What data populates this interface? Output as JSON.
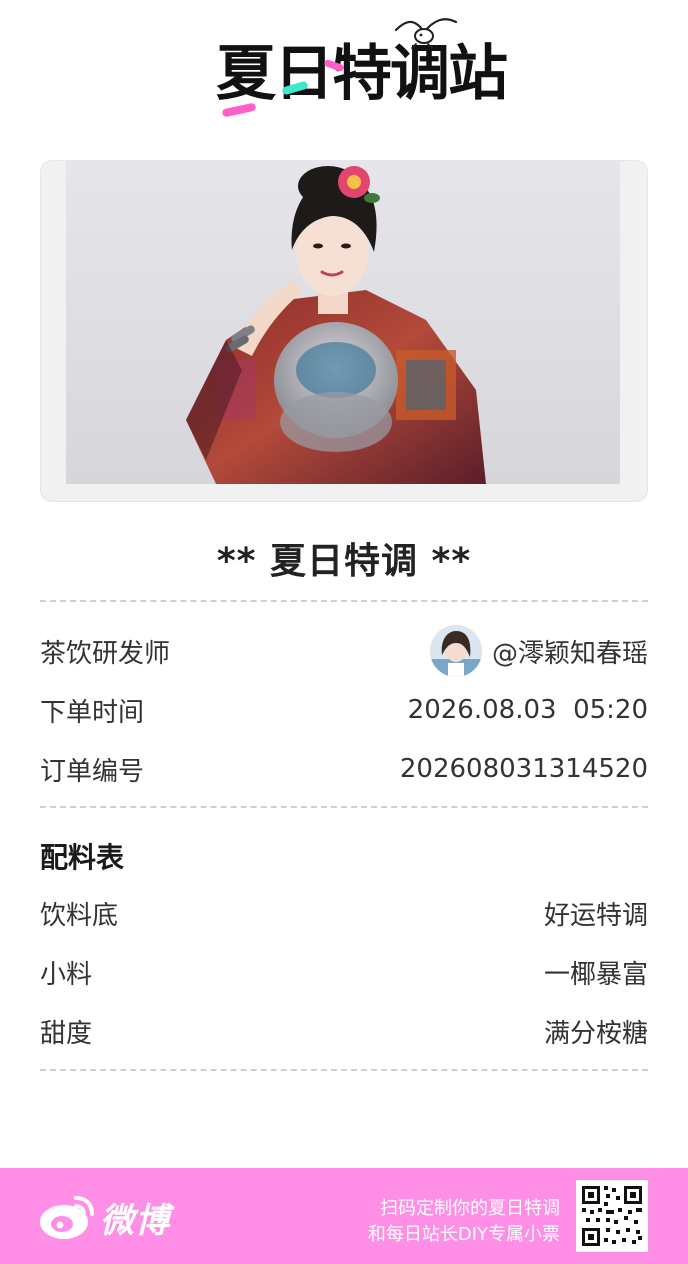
{
  "header": {
    "logo_text": "夏日特调站"
  },
  "ticket": {
    "title": "** 夏日特调 **",
    "info_rows": [
      {
        "label": "茶饮研发师",
        "value": "@澪颖知春瑶"
      },
      {
        "label": "下单时间",
        "value": "2026.08.03  05:20"
      },
      {
        "label": "订单编号",
        "value": "202608031314520"
      }
    ]
  },
  "recipe": {
    "heading": "配料表",
    "rows": [
      {
        "label": "饮料底",
        "value": "好运特调"
      },
      {
        "label": "小料",
        "value": "一椰暴富"
      },
      {
        "label": "甜度",
        "value": "满分桉糖"
      }
    ]
  },
  "footer": {
    "brand": "微博",
    "promo_line1": "扫码定制你的夏日特调",
    "promo_line2": "和每日站长DIY专属小票",
    "background_color": "#ff8fe6"
  },
  "icons": {
    "logo_bird": "seagull-icon",
    "weibo": "weibo-icon",
    "qr": "qr-code-icon"
  }
}
